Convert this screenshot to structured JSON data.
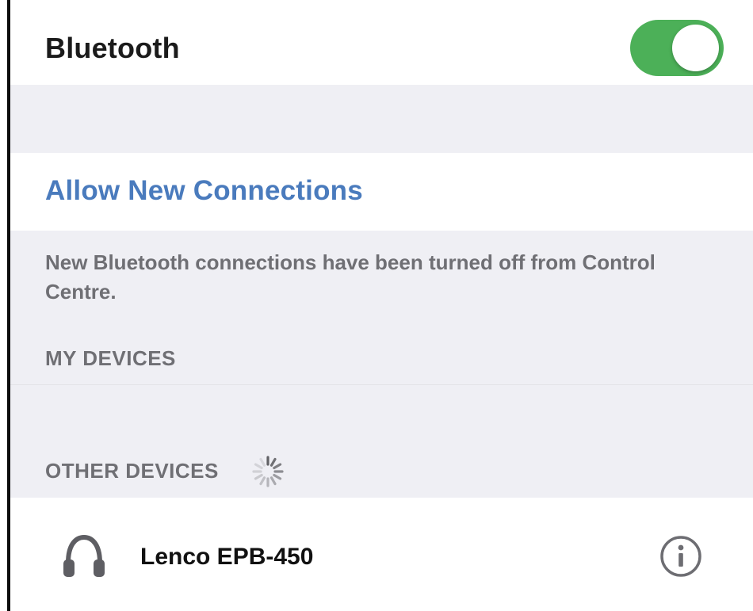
{
  "bluetooth": {
    "title": "Bluetooth",
    "enabled": true,
    "toggle_color": "#4cb058"
  },
  "connections": {
    "allow_label": "Allow New Connections",
    "link_color": "#4a7bbd",
    "note": "New Bluetooth connections have been turned off from Control Centre."
  },
  "my_devices": {
    "header": "MY DEVICES",
    "items": []
  },
  "other_devices": {
    "header": "OTHER DEVICES",
    "searching": true,
    "spinner_icon": "loading-spinner-icon",
    "items": [
      {
        "name": "Lenco EPB-450",
        "icon": "headphones-icon",
        "info_icon": "info-icon"
      }
    ]
  }
}
